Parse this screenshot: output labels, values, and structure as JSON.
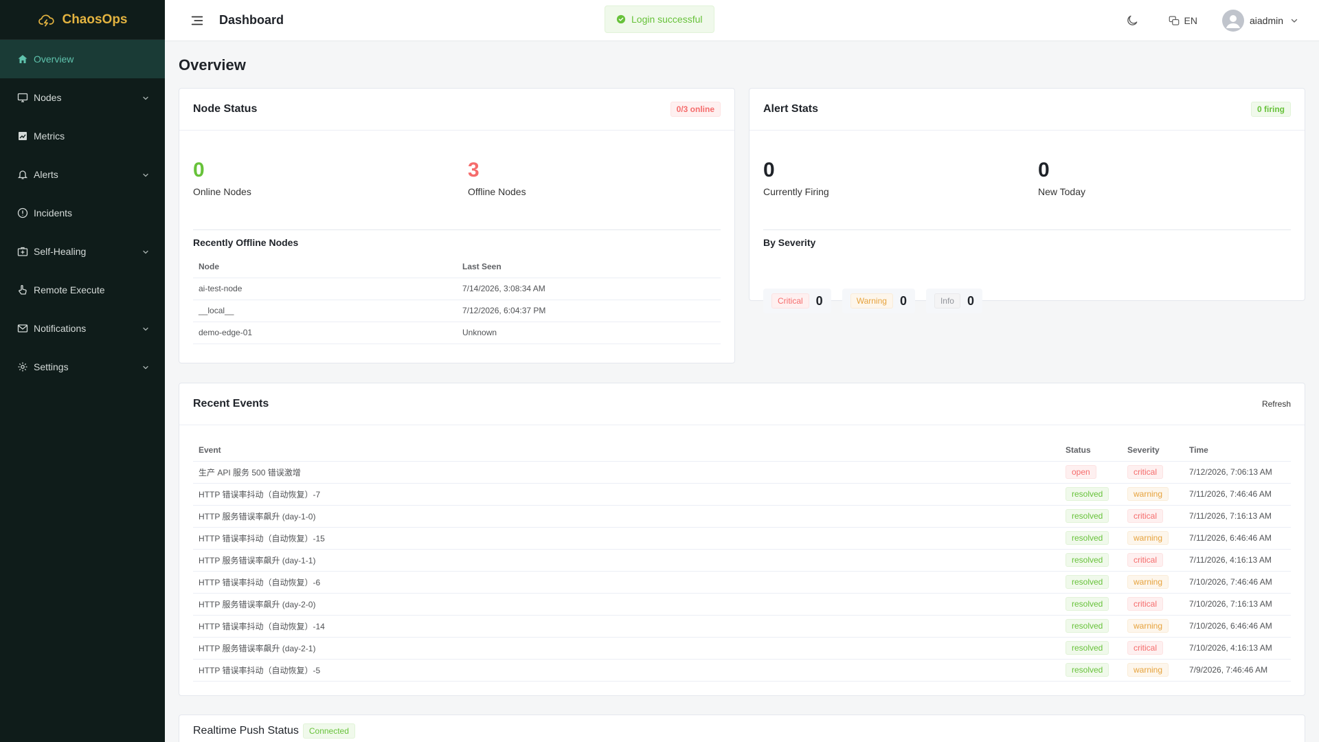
{
  "brand": {
    "name": "ChaosOps"
  },
  "sidebar": {
    "items": [
      {
        "label": "Overview",
        "icon": "home-icon",
        "active": true,
        "expandable": false
      },
      {
        "label": "Nodes",
        "icon": "monitor-icon",
        "active": false,
        "expandable": true
      },
      {
        "label": "Metrics",
        "icon": "chart-icon",
        "active": false,
        "expandable": false
      },
      {
        "label": "Alerts",
        "icon": "bell-icon",
        "active": false,
        "expandable": true
      },
      {
        "label": "Incidents",
        "icon": "warning-circle-icon",
        "active": false,
        "expandable": false
      },
      {
        "label": "Self-Healing",
        "icon": "first-aid-icon",
        "active": false,
        "expandable": true
      },
      {
        "label": "Remote Execute",
        "icon": "pointer-icon",
        "active": false,
        "expandable": false
      },
      {
        "label": "Notifications",
        "icon": "mail-icon",
        "active": false,
        "expandable": true
      },
      {
        "label": "Settings",
        "icon": "gear-icon",
        "active": false,
        "expandable": true
      }
    ]
  },
  "header": {
    "title": "Dashboard",
    "toast": "Login successful",
    "lang": "EN",
    "user": "aiadmin"
  },
  "page": {
    "title": "Overview"
  },
  "node_status": {
    "title": "Node Status",
    "badge": "0/3 online",
    "online_value": "0",
    "online_label": "Online Nodes",
    "offline_value": "3",
    "offline_label": "Offline Nodes",
    "recent_title": "Recently Offline Nodes",
    "columns": [
      "Node",
      "Last Seen"
    ],
    "rows": [
      {
        "node": "ai-test-node",
        "last_seen": "7/14/2026, 3:08:34 AM"
      },
      {
        "node": "__local__",
        "last_seen": "7/12/2026, 6:04:37 PM"
      },
      {
        "node": "demo-edge-01",
        "last_seen": "Unknown"
      }
    ]
  },
  "alert_stats": {
    "title": "Alert Stats",
    "badge": "0 firing",
    "firing_value": "0",
    "firing_label": "Currently Firing",
    "today_value": "0",
    "today_label": "New Today",
    "severity_title": "By Severity",
    "severity": [
      {
        "label": "Critical",
        "count": "0",
        "kind": "danger"
      },
      {
        "label": "Warning",
        "count": "0",
        "kind": "warning"
      },
      {
        "label": "Info",
        "count": "0",
        "kind": "info"
      }
    ]
  },
  "recent_events": {
    "title": "Recent Events",
    "refresh": "Refresh",
    "columns": [
      "Event",
      "Status",
      "Severity",
      "Time"
    ],
    "rows": [
      {
        "event": "生产 API 服务 500 错误激增",
        "status": "open",
        "severity": "critical",
        "time": "7/12/2026, 7:06:13 AM"
      },
      {
        "event": "HTTP 错误率抖动（自动恢复）-7",
        "status": "resolved",
        "severity": "warning",
        "time": "7/11/2026, 7:46:46 AM"
      },
      {
        "event": "HTTP 服务错误率飙升 (day-1-0)",
        "status": "resolved",
        "severity": "critical",
        "time": "7/11/2026, 7:16:13 AM"
      },
      {
        "event": "HTTP 错误率抖动（自动恢复）-15",
        "status": "resolved",
        "severity": "warning",
        "time": "7/11/2026, 6:46:46 AM"
      },
      {
        "event": "HTTP 服务错误率飙升 (day-1-1)",
        "status": "resolved",
        "severity": "critical",
        "time": "7/11/2026, 4:16:13 AM"
      },
      {
        "event": "HTTP 错误率抖动（自动恢复）-6",
        "status": "resolved",
        "severity": "warning",
        "time": "7/10/2026, 7:46:46 AM"
      },
      {
        "event": "HTTP 服务错误率飙升 (day-2-0)",
        "status": "resolved",
        "severity": "critical",
        "time": "7/10/2026, 7:16:13 AM"
      },
      {
        "event": "HTTP 错误率抖动（自动恢复）-14",
        "status": "resolved",
        "severity": "warning",
        "time": "7/10/2026, 6:46:46 AM"
      },
      {
        "event": "HTTP 服务错误率飙升 (day-2-1)",
        "status": "resolved",
        "severity": "critical",
        "time": "7/10/2026, 4:16:13 AM"
      },
      {
        "event": "HTTP 错误率抖动（自动恢复）-5",
        "status": "resolved",
        "severity": "warning",
        "time": "7/9/2026, 7:46:46 AM"
      }
    ]
  },
  "push_status": {
    "title": "Realtime Push Status",
    "badge": "Connected"
  },
  "colors": {
    "accent": "#5fc3ad",
    "brand": "#e3b340",
    "success": "#67c23a",
    "danger": "#f56c6c",
    "warning": "#e6a23c",
    "sidebar_bg": "#0f1c1a"
  }
}
